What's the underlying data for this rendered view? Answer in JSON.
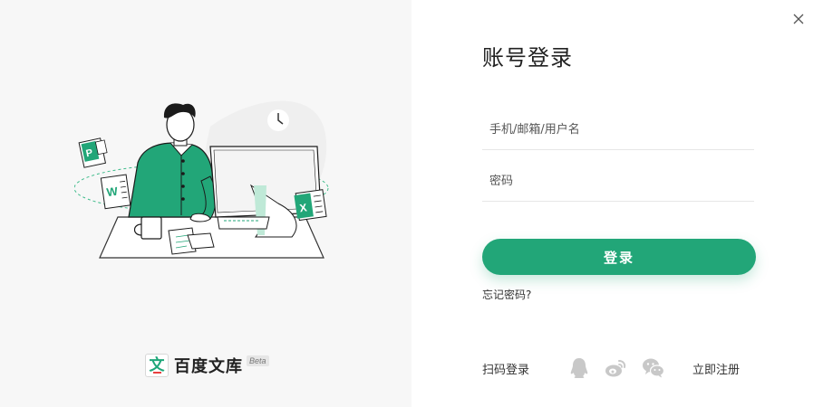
{
  "login": {
    "title": "账号登录",
    "username_placeholder": "手机/邮箱/用户名",
    "password_placeholder": "密码",
    "submit_label": "登录",
    "forgot_label": "忘记密码?",
    "scan_login_label": "扫码登录",
    "register_label": "立即注册"
  },
  "brand": {
    "logo_glyph": "文",
    "name": "百度文库",
    "badge": "Beta"
  },
  "icons": {
    "close": "close-icon",
    "qq": "qq-icon",
    "weibo": "weibo-icon",
    "wechat": "wechat-icon"
  },
  "colors": {
    "accent": "#22a678",
    "panel_bg": "#f7f7f7",
    "social_icon": "#c8c8c8"
  }
}
